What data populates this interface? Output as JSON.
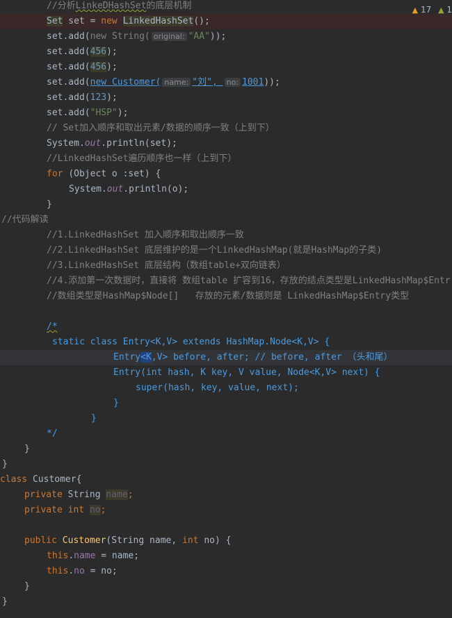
{
  "inspections": {
    "warnings": "17",
    "weak_warnings": "1"
  },
  "code": {
    "l01": {
      "t1": "//分析",
      "t2": "LinkeDHashSet",
      "t3": "的底层机制"
    },
    "l02": {
      "t1": "Set",
      "t2": " set = ",
      "t3": "new ",
      "t4": "LinkedHashSet",
      "t5": "();"
    },
    "l03": {
      "t1": "set.add(",
      "t2": "new ",
      "t3": "String(",
      "hint": "original:",
      "t4": "\"AA\"",
      "t5": "));"
    },
    "l04": {
      "t1": "set.add(",
      "t2": "456",
      "t3": ");"
    },
    "l05": {
      "t1": "set.add(",
      "t2": "456",
      "t3": ");"
    },
    "l06": {
      "t1": "set.add(",
      "t2": "new ",
      "t3": "Customer(",
      "hint1": "name:",
      "t4": "\"刘\"",
      "t5": ", ",
      "hint2": "no:",
      "t6": "1001",
      "t7": "));"
    },
    "l07": {
      "t1": "set.add(",
      "t2": "123",
      "t3": ");"
    },
    "l08": {
      "t1": "set.add(",
      "t2": "\"HSP\"",
      "t3": ");"
    },
    "l09": "// Set加入顺序和取出元素/数据的顺序一致（上到下）",
    "l10": {
      "t1": "System.",
      "t2": "out",
      "t3": ".println(set);"
    },
    "l11": "//LinkedHashSet遍历顺序也一样（上到下）",
    "l12": {
      "t1": "for ",
      "t2": "(Object o :set) {"
    },
    "l13": {
      "t1": "System.",
      "t2": "out",
      "t3": ".println(o);"
    },
    "l14": "}",
    "l15": "//代码解读",
    "l16": "//1.LinkedHashSet 加入顺序和取出顺序一致",
    "l17": "//2.LinkedHashSet 底层维护的是一个LinkedHashMap(就是HashMap的子类)",
    "l18": "//3.LinkedHashSet 底层结构（数组table+双向链表）",
    "l19": "//4.添加第一次数据时，直接将 数组table 扩容到16，存放的结点类型是LinkedHashMap$Entr",
    "l20": "//数组类型是HashMap$Node[]   存放的元素/数据则是 LinkedHashMap$Entry类型",
    "l22": "/*",
    "l23": "static class Entry<K,V> extends HashMap.Node<K,V> {",
    "l24": {
      "t1": "Entry",
      "t2": "<K",
      "t3": ",V> before, after; // before, after （头和尾）"
    },
    "l25": "Entry(int hash, K key, V value, Node<K,V> next) {",
    "l26": "super(hash, key, value, next);",
    "l27": "}",
    "l28": "}",
    "l29": "*/",
    "l30": "}",
    "l31": "}",
    "l32": {
      "t1": "class ",
      "t2": "Customer{"
    },
    "l33": {
      "t1": "private ",
      "t2": "String ",
      "t3": "name",
      "t4": ";"
    },
    "l34": {
      "t1": "private ",
      "t2": "int ",
      "t3": "no",
      "t4": ";"
    },
    "l36": {
      "t1": "public ",
      "t2": "Customer",
      "t3": "(String name, ",
      "t4": "int ",
      "t5": "no) {"
    },
    "l37": {
      "t1": "this",
      "t2": ".",
      "t3": "name",
      "t4": " = name;"
    },
    "l38": {
      "t1": "this",
      "t2": ".",
      "t3": "no",
      "t4": " = no;"
    },
    "l39": "}",
    "l40": "}"
  },
  "colors": {
    "background": "#2b2b2b",
    "comment": "#808080",
    "doc_comment": "#629755",
    "keyword": "#cc7832",
    "string": "#6a8759",
    "number": "#6897bb",
    "field": "#9876aa",
    "method": "#ffc66d",
    "current_line": "#323438"
  }
}
